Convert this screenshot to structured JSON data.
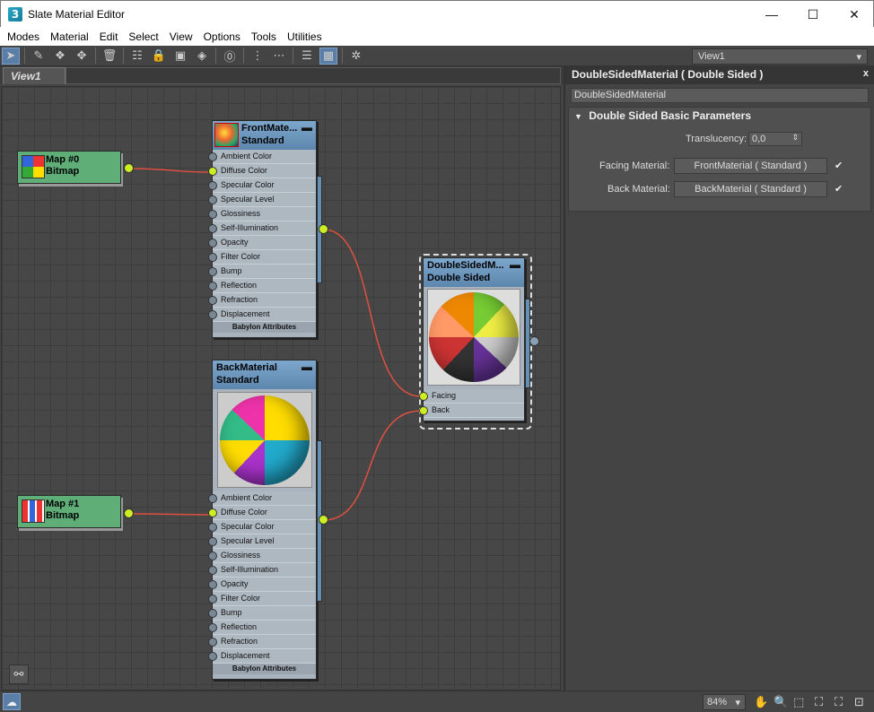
{
  "window": {
    "app_icon_label": "3",
    "title": "Slate Material Editor",
    "minimize_glyph": "—",
    "maximize_glyph": "☐",
    "close_glyph": "✕"
  },
  "menu": [
    "Modes",
    "Material",
    "Edit",
    "Select",
    "View",
    "Options",
    "Tools",
    "Utilities"
  ],
  "toolbar": {
    "view_select_value": "View1",
    "icons": [
      "select-icon",
      "pick-material-icon",
      "layout-icon",
      "move-children-icon",
      "delete-icon",
      "layout-all-icon",
      "lock-icon",
      "show-map-icon",
      "show-background-icon",
      "background-icon",
      "preview-icon",
      "layout-vertical-icon",
      "layout-horizontal-icon",
      "hide-unused-icon",
      "navigator-icon",
      "render-icon"
    ]
  },
  "view": {
    "tab_label": "View1"
  },
  "nodes": {
    "map0": {
      "name": "Map #0",
      "type": "Bitmap"
    },
    "map1": {
      "name": "Map #1",
      "type": "Bitmap"
    },
    "front": {
      "name": "FrontMate...",
      "type": "Standard",
      "slots": [
        "Ambient Color",
        "Diffuse Color",
        "Specular Color",
        "Specular Level",
        "Glossiness",
        "Self-Illumination",
        "Opacity",
        "Filter Color",
        "Bump",
        "Reflection",
        "Refraction",
        "Displacement"
      ],
      "footer": "Babylon Attributes"
    },
    "back": {
      "name": "BackMaterial",
      "type": "Standard",
      "slots": [
        "Ambient Color",
        "Diffuse Color",
        "Specular Color",
        "Specular Level",
        "Glossiness",
        "Self-Illumination",
        "Opacity",
        "Filter Color",
        "Bump",
        "Reflection",
        "Refraction",
        "Displacement"
      ],
      "footer": "Babylon Attributes"
    },
    "double": {
      "name": "DoubleSidedM...",
      "type": "Double Sided",
      "slots": [
        "Facing",
        "Back"
      ]
    }
  },
  "panel": {
    "title": "DoubleSidedMaterial  ( Double Sided )",
    "close_glyph": "x",
    "name_field": "DoubleSidedMaterial",
    "rollout_title": "Double Sided Basic Parameters",
    "translucency_label": "Translucency:",
    "translucency_value": "0,0",
    "facing_label": "Facing Material:",
    "facing_value": "FrontMaterial  ( Standard )",
    "back_label": "Back Material:",
    "back_value": "BackMaterial  ( Standard )",
    "check_glyph": "✔"
  },
  "status": {
    "zoom": "84%",
    "icons": [
      "pan-icon",
      "zoom-icon",
      "zoom-region-icon",
      "zoom-extents-icon",
      "zoom-extents-selected-icon",
      "frame-icon"
    ]
  },
  "colors": {
    "wire": "#e05040",
    "slot_active": "#ccee22",
    "node_header": "#6f98be",
    "map_node": "#5fae78"
  }
}
